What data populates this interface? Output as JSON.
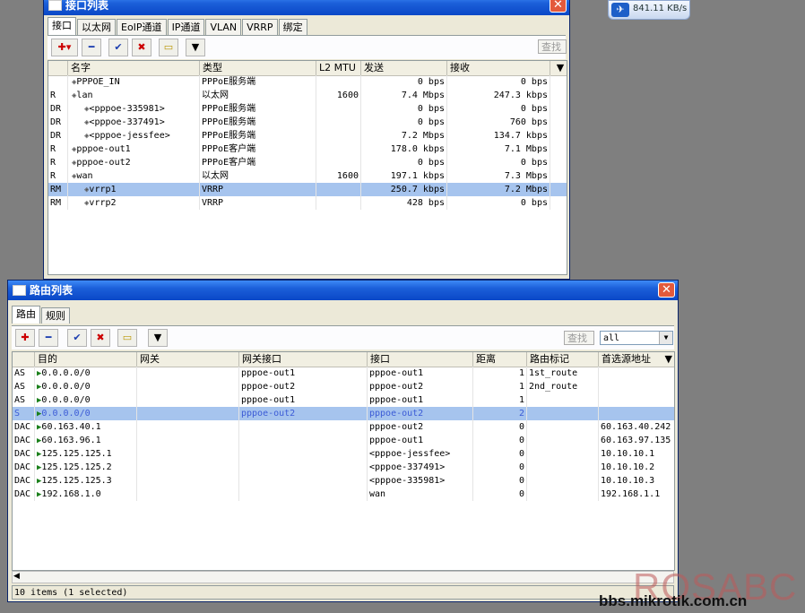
{
  "speed_widget": {
    "value": "841.11 KB/s"
  },
  "watermark": {
    "logo": "ROSABC",
    "url": "bbs.mikrotik.com.cn"
  },
  "interface_window": {
    "title": "接口列表",
    "tabs": [
      "接口",
      "以太网",
      "EoIP通道",
      "IP通道",
      "VLAN",
      "VRRP",
      "绑定"
    ],
    "find_label": "查找",
    "columns": [
      "名字",
      "类型",
      "L2 MTU",
      "发送",
      "接收"
    ],
    "rows": [
      {
        "flag": "",
        "name": "PPPOE_IN",
        "type": "PPPoE服务端",
        "mtu": "",
        "tx": "0 bps",
        "rx": "0 bps",
        "indent": 1
      },
      {
        "flag": "R",
        "name": "lan",
        "type": "以太网",
        "mtu": "1600",
        "tx": "7.4 Mbps",
        "rx": "247.3 kbps",
        "indent": 1
      },
      {
        "flag": "DR",
        "name": "<pppoe-335981>",
        "type": "PPPoE服务端",
        "mtu": "",
        "tx": "0 bps",
        "rx": "0 bps",
        "indent": 2
      },
      {
        "flag": "DR",
        "name": "<pppoe-337491>",
        "type": "PPPoE服务端",
        "mtu": "",
        "tx": "0 bps",
        "rx": "760 bps",
        "indent": 2
      },
      {
        "flag": "DR",
        "name": "<pppoe-jessfee>",
        "type": "PPPoE服务端",
        "mtu": "",
        "tx": "7.2 Mbps",
        "rx": "134.7 kbps",
        "indent": 2
      },
      {
        "flag": "R",
        "name": "pppoe-out1",
        "type": "PPPoE客户端",
        "mtu": "",
        "tx": "178.0 kbps",
        "rx": "7.1 Mbps",
        "indent": 1
      },
      {
        "flag": "R",
        "name": "pppoe-out2",
        "type": "PPPoE客户端",
        "mtu": "",
        "tx": "0 bps",
        "rx": "0 bps",
        "indent": 1
      },
      {
        "flag": "R",
        "name": "wan",
        "type": "以太网",
        "mtu": "1600",
        "tx": "197.1 kbps",
        "rx": "7.3 Mbps",
        "indent": 1
      },
      {
        "flag": "RM",
        "name": "vrrp1",
        "type": "VRRP",
        "mtu": "",
        "tx": "250.7 kbps",
        "rx": "7.2 Mbps",
        "indent": 2,
        "selected": true
      },
      {
        "flag": "RM",
        "name": "vrrp2",
        "type": "VRRP",
        "mtu": "",
        "tx": "428 bps",
        "rx": "0 bps",
        "indent": 2
      }
    ]
  },
  "route_window": {
    "title": "路由列表",
    "tabs": [
      "路由",
      "规则"
    ],
    "find_label": "查找",
    "filter_value": "all",
    "columns": [
      "目的",
      "网关",
      "网关接口",
      "接口",
      "距离",
      "路由标记",
      "首选源地址"
    ],
    "rows": [
      {
        "flag": "AS",
        "dst": "0.0.0.0/0",
        "gw": "",
        "gw_if": "pppoe-out1",
        "iface": "pppoe-out1",
        "dist": "1",
        "mark": "1st_route",
        "src": ""
      },
      {
        "flag": "AS",
        "dst": "0.0.0.0/0",
        "gw": "",
        "gw_if": "pppoe-out2",
        "iface": "pppoe-out2",
        "dist": "1",
        "mark": "2nd_route",
        "src": ""
      },
      {
        "flag": "AS",
        "dst": "0.0.0.0/0",
        "gw": "",
        "gw_if": "pppoe-out1",
        "iface": "pppoe-out1",
        "dist": "1",
        "mark": "",
        "src": ""
      },
      {
        "flag": "S",
        "dst": "0.0.0.0/0",
        "gw": "",
        "gw_if": "pppoe-out2",
        "iface": "pppoe-out2",
        "dist": "2",
        "mark": "",
        "src": "",
        "selected": true
      },
      {
        "flag": "DAC",
        "dst": "60.163.40.1",
        "gw": "",
        "gw_if": "",
        "iface": "pppoe-out2",
        "dist": "0",
        "mark": "",
        "src": "60.163.40.242"
      },
      {
        "flag": "DAC",
        "dst": "60.163.96.1",
        "gw": "",
        "gw_if": "",
        "iface": "pppoe-out1",
        "dist": "0",
        "mark": "",
        "src": "60.163.97.135"
      },
      {
        "flag": "DAC",
        "dst": "125.125.125.1",
        "gw": "",
        "gw_if": "",
        "iface": "<pppoe-jessfee>",
        "dist": "0",
        "mark": "",
        "src": "10.10.10.1"
      },
      {
        "flag": "DAC",
        "dst": "125.125.125.2",
        "gw": "",
        "gw_if": "",
        "iface": "<pppoe-337491>",
        "dist": "0",
        "mark": "",
        "src": "10.10.10.2"
      },
      {
        "flag": "DAC",
        "dst": "125.125.125.3",
        "gw": "",
        "gw_if": "",
        "iface": "<pppoe-335981>",
        "dist": "0",
        "mark": "",
        "src": "10.10.10.3"
      },
      {
        "flag": "DAC",
        "dst": "192.168.1.0",
        "gw": "",
        "gw_if": "",
        "iface": "wan",
        "dist": "0",
        "mark": "",
        "src": "192.168.1.1"
      }
    ],
    "status": "10 items (1 selected)"
  },
  "colors": {
    "selection": "#a6c4ee",
    "titlebar": "#1b5fd9",
    "close": "#e35a3c"
  }
}
